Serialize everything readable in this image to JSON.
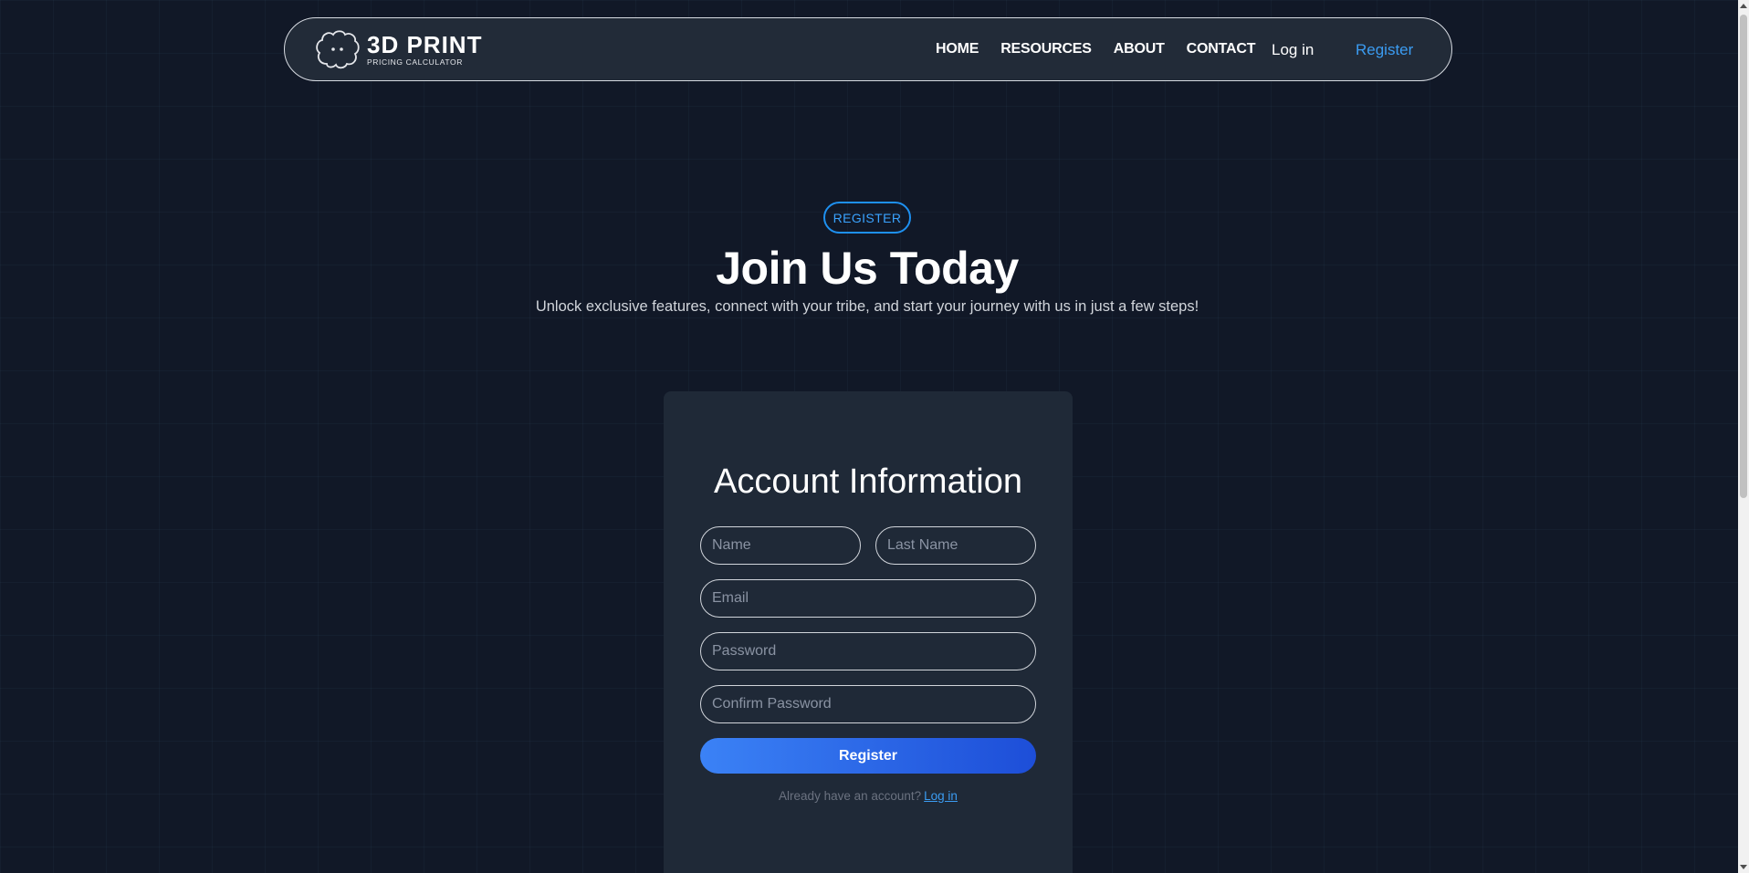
{
  "navbar": {
    "logo": {
      "main": "3D PRINT",
      "sub": "PRICING CALCULATOR",
      "icon": "brain-icon"
    },
    "links": [
      "HOME",
      "RESOURCES",
      "ABOUT",
      "CONTACT"
    ],
    "login_label": "Log in",
    "register_label": "Register"
  },
  "hero": {
    "badge": "REGISTER",
    "title": "Join Us Today",
    "subtitle": "Unlock exclusive features, connect with your tribe, and start your journey with us in just a few steps!"
  },
  "form": {
    "title": "Account Information",
    "name_placeholder": "Name",
    "last_name_placeholder": "Last Name",
    "email_placeholder": "Email",
    "password_placeholder": "Password",
    "confirm_password_placeholder": "Confirm Password",
    "submit_label": "Register",
    "already_text": "Already have an account?",
    "login_link": "Log in"
  },
  "colors": {
    "background": "#111827",
    "card": "#1f2937",
    "accent": "#3b9cf2",
    "button_gradient_start": "#3b82f6",
    "button_gradient_end": "#1d4ed8"
  }
}
